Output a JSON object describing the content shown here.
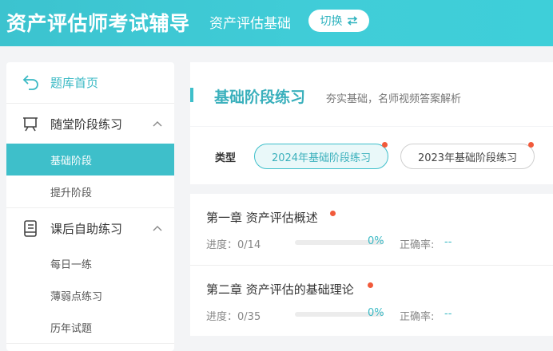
{
  "header": {
    "app_title": "资产评估师考试辅导",
    "subject": "资产评估基础",
    "switch_label": "切换"
  },
  "sidebar": {
    "home_label": "题库首页",
    "groups": [
      {
        "label": "随堂阶段练习",
        "icon": "easel-icon",
        "items": [
          {
            "label": "基础阶段",
            "active": true
          },
          {
            "label": "提升阶段"
          }
        ]
      },
      {
        "label": "课后自助练习",
        "icon": "notebook-icon",
        "items": [
          {
            "label": "每日一练"
          },
          {
            "label": "薄弱点练习"
          },
          {
            "label": "历年试题"
          }
        ]
      }
    ]
  },
  "main": {
    "title": "基础阶段练习",
    "description": "夯实基础，名师视频答案解析",
    "filter": {
      "type_label": "类型",
      "options": [
        {
          "label": "2024年基础阶段练习",
          "selected": true,
          "badge": true
        },
        {
          "label": "2023年基础阶段练习",
          "selected": false,
          "badge": true
        }
      ]
    },
    "chapters": [
      {
        "title": "第一章 资产评估概述",
        "progress_label": "进度：",
        "progress": "0/14",
        "percent": "0%",
        "percent_value": 0,
        "accuracy_label": "正确率:",
        "accuracy": "--"
      },
      {
        "title": "第二章 资产评估的基础理论",
        "progress_label": "进度：",
        "progress": "0/35",
        "percent": "0%",
        "percent_value": 0,
        "accuracy_label": "正确率:",
        "accuracy": "--"
      }
    ]
  },
  "colors": {
    "accent": "#3ebfca",
    "badge": "#f15a3b"
  }
}
